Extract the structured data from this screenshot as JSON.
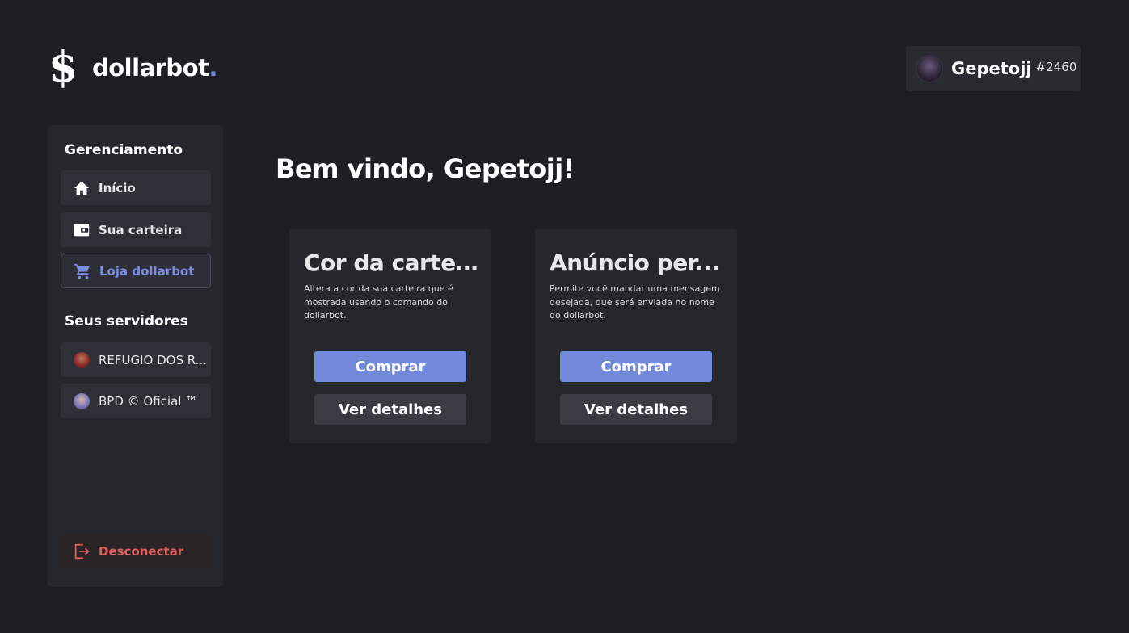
{
  "brand": {
    "mark": "$",
    "name": "dollarbot",
    "dot": "."
  },
  "user": {
    "name": "Gepetojj",
    "tag": "#2460",
    "avatar_icon": "user-avatar"
  },
  "sidebar": {
    "management_heading": "Gerenciamento",
    "nav": [
      {
        "label": "Início",
        "icon": "home-icon",
        "active": false
      },
      {
        "label": "Sua carteira",
        "icon": "wallet-icon",
        "active": false
      },
      {
        "label": "Loja dollarbot",
        "icon": "cart-icon",
        "active": true
      }
    ],
    "servers_heading": "Seus servidores",
    "servers": [
      {
        "label": "REFUGIO DOS R...",
        "icon": "server-avatar"
      },
      {
        "label": "BPD © Oficial ™",
        "icon": "server-avatar"
      }
    ],
    "logout_label": "Desconectar"
  },
  "main": {
    "welcome": "Bem vindo, Gepetojj!",
    "cards": [
      {
        "title": "Cor da cartei...",
        "description": "Altera a cor da sua carteira que é mostrada usando o comando do dollarbot.",
        "buy_label": "Comprar",
        "details_label": "Ver detalhes"
      },
      {
        "title": "Anúncio per...",
        "description": "Permite você mandar uma mensagem desejada, que será enviada no nome do dollarbot.",
        "buy_label": "Comprar",
        "details_label": "Ver detalhes"
      }
    ]
  },
  "colors": {
    "background": "#1e1f23",
    "panel": "#26272d",
    "accent": "#7289da",
    "active_text": "#7c8ce0",
    "danger": "#e05e5e"
  }
}
